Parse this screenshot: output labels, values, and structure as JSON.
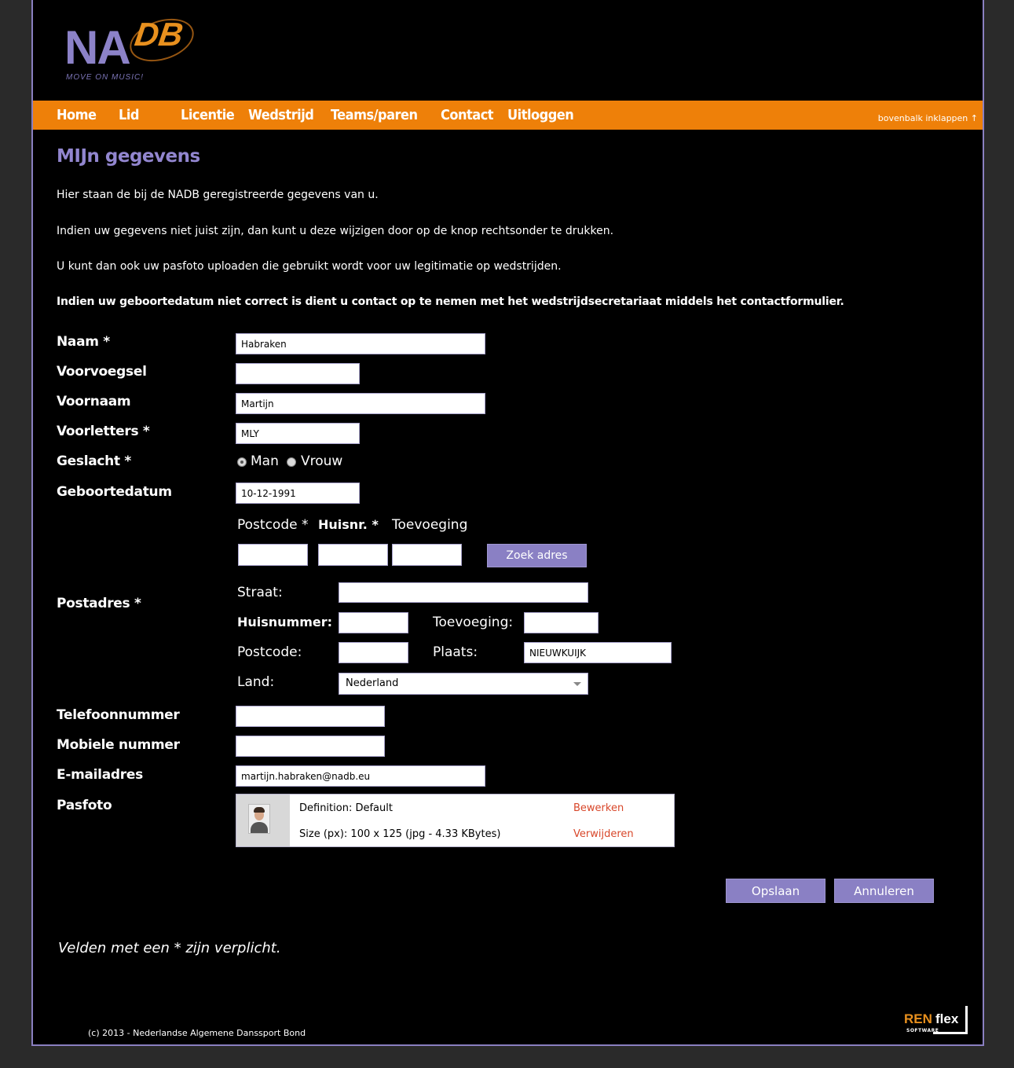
{
  "logo": {
    "main": "NA",
    "accent": "DB",
    "tagline": "MOVE ON MUSIC!"
  },
  "nav": {
    "items": [
      "Home",
      "Lid",
      "Licentie",
      "Wedstrijd",
      "Teams/paren",
      "Contact",
      "Uitloggen"
    ],
    "collapse": "bovenbalk inklappen ↑"
  },
  "page": {
    "title": "MIJn gegevens",
    "intro1": "Hier staan de bij de NADB geregistreerde gegevens van u.",
    "intro2": "Indien uw gegevens niet juist zijn, dan kunt u deze wijzigen door op de knop rechtsonder te drukken.",
    "intro3": "U kunt dan ook uw pasfoto uploaden die gebruikt wordt voor uw legitimatie op wedstrijden.",
    "intro4": "Indien uw geboortedatum niet correct is dient u contact op te nemen met het wedstrijdsecretariaat middels het contactformulier."
  },
  "form": {
    "naam_label": "Naam *",
    "naam_value": "Habraken",
    "voorvoegsel_label": "Voorvoegsel",
    "voorvoegsel_value": "",
    "voornaam_label": "Voornaam",
    "voornaam_value": "Martijn",
    "voorletters_label": "Voorletters *",
    "voorletters_value": "MLY",
    "geslacht_label": "Geslacht *",
    "geslacht_man": "Man",
    "geslacht_vrouw": "Vrouw",
    "geslacht_selected": "Man",
    "geboortedatum_label": "Geboortedatum",
    "geboortedatum_value": "10-12-1991",
    "postadres_label": "Postadres *",
    "lookup_postcode": "Postcode *",
    "lookup_huisnr": "Huisnr. *",
    "lookup_toevoeging": "Toevoeging",
    "zoek_button": "Zoek adres",
    "straat_label": "Straat:",
    "straat_value": "",
    "huisnummer_label": "Huisnummer:",
    "huisnummer_value": "",
    "toevoeging_label": "Toevoeging:",
    "toevoeging_value": "",
    "postcode_label": "Postcode:",
    "postcode_value": "",
    "plaats_label": "Plaats:",
    "plaats_value": "NIEUWKUIJK",
    "land_label": "Land:",
    "land_value": "Nederland",
    "telefoon_label": "Telefoonnummer",
    "telefoon_value": "",
    "mobiel_label": "Mobiele nummer",
    "mobiel_value": "",
    "email_label": "E-mailadres",
    "email_value": "martijn.habraken@nadb.eu",
    "pasfoto_label": "Pasfoto",
    "photo_definition": "Definition: Default",
    "photo_size": "Size (px): 100 x 125  (jpg - 4.33 KBytes)",
    "photo_edit": "Bewerken",
    "photo_delete": "Verwijderen"
  },
  "actions": {
    "save": "Opslaan",
    "cancel": "Annuleren"
  },
  "footer": {
    "required_note": "Velden met een * zijn verplicht.",
    "copyright": "(c) 2013 - Nederlandse Algemene Danssport Bond",
    "vendor_ren": "REN",
    "vendor_flex": "flex",
    "vendor_software": "SOFTWARE"
  },
  "colors": {
    "nav": "#ee8009",
    "accent": "#9286cf",
    "link": "#d8472a"
  }
}
